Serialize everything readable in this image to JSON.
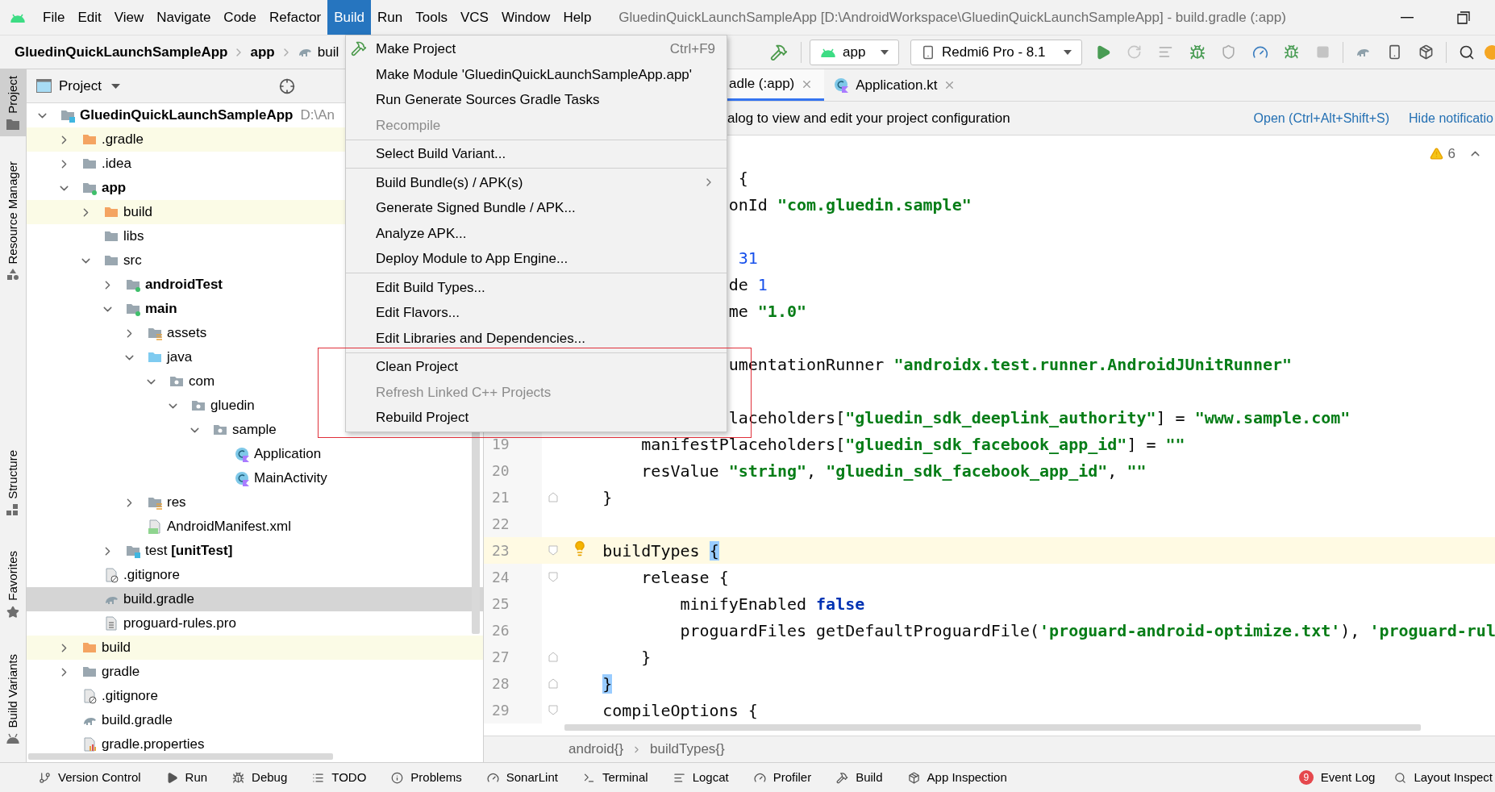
{
  "menu_bar": {
    "items": [
      {
        "label": "File",
        "selected": false
      },
      {
        "label": "Edit",
        "selected": false
      },
      {
        "label": "View",
        "selected": false
      },
      {
        "label": "Navigate",
        "selected": false
      },
      {
        "label": "Code",
        "selected": false
      },
      {
        "label": "Refactor",
        "selected": false
      },
      {
        "label": "Build",
        "selected": true
      },
      {
        "label": "Run",
        "selected": false
      },
      {
        "label": "Tools",
        "selected": false
      },
      {
        "label": "VCS",
        "selected": false
      },
      {
        "label": "Window",
        "selected": false
      },
      {
        "label": "Help",
        "selected": false
      }
    ],
    "title": "GluedinQuickLaunchSampleApp [D:\\AndroidWorkspace\\GluedinQuickLaunchSampleApp] - build.gradle (:app)"
  },
  "navigation_bar": {
    "crumbs": [
      {
        "label": "GluedinQuickLaunchSampleApp",
        "kind": "project"
      },
      {
        "label": "app",
        "kind": "module"
      },
      {
        "label": "buil",
        "kind": "gradle"
      }
    ],
    "run_config": "app",
    "device": "Redmi6 Pro - 8.1"
  },
  "tool_strip": [
    {
      "label": "Project",
      "kind": "project",
      "selected": true
    },
    {
      "label": "Resource Manager",
      "kind": "resources",
      "selected": false
    },
    {
      "label": "Structure",
      "kind": "structure",
      "selected": false
    },
    {
      "label": "Favorites",
      "kind": "favorites",
      "selected": false
    },
    {
      "label": "Build Variants",
      "kind": "variants",
      "selected": false
    }
  ],
  "project_panel": {
    "title": "Project",
    "tree": [
      {
        "name": "GluedinQuickLaunchSampleApp",
        "path": "D:\\An",
        "kind": "project",
        "expanded": true,
        "selected": false,
        "children": [
          {
            "name": ".gradle",
            "kind": "excluded",
            "expanded": false,
            "selected": false
          },
          {
            "name": ".idea",
            "kind": "folder",
            "expanded": false,
            "selected": false
          },
          {
            "name": "app",
            "kind": "module",
            "expanded": true,
            "selected": false,
            "children": [
              {
                "name": "build",
                "kind": "excluded",
                "expanded": false,
                "selected": false
              },
              {
                "name": "libs",
                "kind": "folder",
                "selected": false
              },
              {
                "name": "src",
                "kind": "folder",
                "expanded": true,
                "selected": false,
                "children": [
                  {
                    "name": "androidTest",
                    "kind": "source-set",
                    "expanded": false,
                    "selected": false
                  },
                  {
                    "name": "main",
                    "kind": "source-set",
                    "expanded": true,
                    "selected": false,
                    "children": [
                      {
                        "name": "assets",
                        "kind": "resource",
                        "expanded": false,
                        "selected": false
                      },
                      {
                        "name": "java",
                        "kind": "source-root",
                        "expanded": true,
                        "selected": false,
                        "children": [
                          {
                            "name": "com",
                            "kind": "package",
                            "expanded": true,
                            "selected": false,
                            "children": [
                              {
                                "name": "gluedin",
                                "kind": "package",
                                "expanded": true,
                                "selected": false,
                                "children": [
                                  {
                                    "name": "sample",
                                    "kind": "package",
                                    "expanded": true,
                                    "selected": false,
                                    "children": [
                                      {
                                        "name": "Application",
                                        "kind": "class",
                                        "selected": false
                                      },
                                      {
                                        "name": "MainActivity",
                                        "kind": "class",
                                        "selected": false
                                      }
                                    ]
                                  }
                                ]
                              }
                            ]
                          }
                        ]
                      },
                      {
                        "name": "res",
                        "kind": "resource",
                        "expanded": false,
                        "selected": false
                      },
                      {
                        "name": "AndroidManifest.xml",
                        "kind": "manifest",
                        "selected": false
                      }
                    ]
                  },
                  {
                    "name": "test **[unitTest]**",
                    "kind": "test-set",
                    "expanded": false,
                    "selected": false
                  }
                ]
              },
              {
                "name": ".gitignore",
                "kind": "ignore",
                "selected": false
              },
              {
                "name": "build.gradle",
                "kind": "gradle",
                "selected": true
              },
              {
                "name": "proguard-rules.pro",
                "kind": "text",
                "selected": false
              }
            ]
          },
          {
            "name": "build",
            "kind": "excluded",
            "expanded": false,
            "selected": false
          },
          {
            "name": "gradle",
            "kind": "folder",
            "expanded": false,
            "selected": false
          },
          {
            "name": ".gitignore",
            "kind": "ignore",
            "selected": false
          },
          {
            "name": "build.gradle",
            "kind": "gradle",
            "selected": false
          },
          {
            "name": "gradle.properties",
            "kind": "properties",
            "selected": false
          }
        ]
      }
    ]
  },
  "editor": {
    "tabs": [
      {
        "label": "adle (:app)",
        "selected": true
      },
      {
        "label": "Application.kt",
        "kind": "class",
        "selected": false
      }
    ],
    "notification": {
      "text": "alog to view and edit your project configuration",
      "links": [
        "Open (Ctrl+Alt+Shift+S)",
        "Hide notificatio"
      ]
    },
    "warnings": "6",
    "lines": [
      {
        "kind": "partial"
      },
      {
        "kind": "partial",
        "tokens": [
          {
            "kind": "plain",
            "text": " {"
          }
        ]
      },
      {
        "kind": "partial",
        "tokens": [
          {
            "kind": "plain",
            "text": "onId "
          },
          {
            "kind": "string",
            "text": "\"com.gluedin.sample\""
          }
        ]
      },
      {
        "kind": "partial"
      },
      {
        "kind": "partial",
        "tokens": [
          {
            "kind": "number",
            "text": " 31"
          }
        ]
      },
      {
        "kind": "partial",
        "tokens": [
          {
            "kind": "plain",
            "text": "de "
          },
          {
            "kind": "number",
            "text": "1"
          }
        ]
      },
      {
        "kind": "partial",
        "tokens": [
          {
            "kind": "plain",
            "text": "me "
          },
          {
            "kind": "string",
            "text": "\"1.0\""
          }
        ]
      },
      {
        "kind": "partial"
      },
      {
        "kind": "partial",
        "tokens": [
          {
            "kind": "plain",
            "text": "umentationRunner "
          },
          {
            "kind": "string",
            "text": "\"androidx.test.runner.AndroidJUnitRunner\""
          }
        ]
      },
      {
        "kind": "partial"
      },
      {
        "kind": "partial",
        "tokens": [
          {
            "kind": "plain",
            "text": "laceholders["
          },
          {
            "kind": "string",
            "text": "\"gluedin_sdk_deeplink_authority\""
          },
          {
            "kind": "plain",
            "text": "] = "
          },
          {
            "kind": "string",
            "text": "\"www.sample.com\""
          }
        ]
      },
      {
        "kind": "numbered",
        "number": "19",
        "current": false,
        "fold_start": false,
        "fold_end": false,
        "tokens": [
          {
            "kind": "plain",
            "text": "        manifestPlaceholders["
          },
          {
            "kind": "string",
            "text": "\"gluedin_sdk_facebook_app_id\""
          },
          {
            "kind": "plain",
            "text": "] = "
          },
          {
            "kind": "string",
            "text": "\"\""
          }
        ]
      },
      {
        "kind": "numbered",
        "number": "20",
        "current": false,
        "fold_start": false,
        "fold_end": false,
        "tokens": [
          {
            "kind": "plain",
            "text": "        resValue "
          },
          {
            "kind": "string",
            "text": "\"string\""
          },
          {
            "kind": "plain",
            "text": ", "
          },
          {
            "kind": "string",
            "text": "\"gluedin_sdk_facebook_app_id\""
          },
          {
            "kind": "plain",
            "text": ", "
          },
          {
            "kind": "string",
            "text": "\"\""
          }
        ]
      },
      {
        "kind": "numbered",
        "number": "21",
        "current": false,
        "fold_start": false,
        "fold_end": true,
        "tokens": [
          {
            "kind": "plain",
            "text": "    }"
          }
        ]
      },
      {
        "kind": "numbered",
        "number": "22",
        "current": false,
        "fold_start": false,
        "fold_end": false
      },
      {
        "kind": "numbered",
        "number": "23",
        "current": true,
        "fold_start": true,
        "fold_end": false,
        "tokens": [
          {
            "kind": "plain",
            "text": "    buildTypes "
          },
          {
            "kind": "match",
            "text": "{"
          }
        ]
      },
      {
        "kind": "numbered",
        "number": "24",
        "current": false,
        "fold_start": true,
        "fold_end": false,
        "tokens": [
          {
            "kind": "plain",
            "text": "        release {"
          }
        ]
      },
      {
        "kind": "numbered",
        "number": "25",
        "current": false,
        "fold_start": false,
        "fold_end": false,
        "tokens": [
          {
            "kind": "plain",
            "text": "            minifyEnabled "
          },
          {
            "kind": "keyword",
            "text": "false"
          }
        ]
      },
      {
        "kind": "numbered",
        "number": "26",
        "current": false,
        "fold_start": false,
        "fold_end": false,
        "tokens": [
          {
            "kind": "plain",
            "text": "            proguardFiles getDefaultProguardFile("
          },
          {
            "kind": "string",
            "text": "'proguard-android-optimize.txt'"
          },
          {
            "kind": "plain",
            "text": "), "
          },
          {
            "kind": "string",
            "text": "'proguard-rul"
          }
        ]
      },
      {
        "kind": "numbered",
        "number": "27",
        "current": false,
        "fold_start": false,
        "fold_end": true,
        "tokens": [
          {
            "kind": "plain",
            "text": "        }"
          }
        ]
      },
      {
        "kind": "numbered",
        "number": "28",
        "current": false,
        "fold_start": false,
        "fold_end": true,
        "tokens": [
          {
            "kind": "match",
            "text": "    }"
          }
        ]
      },
      {
        "kind": "numbered",
        "number": "29",
        "current": false,
        "fold_start": true,
        "fold_end": false,
        "tokens": [
          {
            "kind": "plain",
            "text": "    compileOptions {"
          }
        ]
      }
    ],
    "breadcrumb": [
      "android{}",
      "buildTypes{}"
    ]
  },
  "build_menu": [
    {
      "kind": "action",
      "label": "Make Project",
      "shortcut": "Ctrl+F9",
      "disabled": false
    },
    {
      "kind": "item",
      "label": "Make Module 'GluedinQuickLaunchSampleApp.app'",
      "disabled": false
    },
    {
      "kind": "item",
      "label": "Run Generate Sources Gradle Tasks",
      "disabled": false
    },
    {
      "kind": "item",
      "label": "Recompile",
      "disabled": true
    },
    {
      "kind": "separator"
    },
    {
      "kind": "item",
      "label": "Select Build Variant...",
      "disabled": false
    },
    {
      "kind": "separator"
    },
    {
      "kind": "submenu",
      "label": "Build Bundle(s) / APK(s)",
      "disabled": false
    },
    {
      "kind": "item",
      "label": "Generate Signed Bundle / APK...",
      "disabled": false
    },
    {
      "kind": "item",
      "label": "Analyze APK...",
      "disabled": false
    },
    {
      "kind": "item",
      "label": "Deploy Module to App Engine...",
      "disabled": false
    },
    {
      "kind": "separator"
    },
    {
      "kind": "item",
      "label": "Edit Build Types...",
      "disabled": false
    },
    {
      "kind": "item",
      "label": "Edit Flavors...",
      "disabled": false
    },
    {
      "kind": "item",
      "label": "Edit Libraries and Dependencies...",
      "disabled": false
    },
    {
      "kind": "separator"
    },
    {
      "kind": "item",
      "label": "Clean Project",
      "disabled": false
    },
    {
      "kind": "item",
      "label": "Refresh Linked C++ Projects",
      "disabled": true
    },
    {
      "kind": "item",
      "label": "Rebuild Project",
      "disabled": false
    }
  ],
  "bottom_bar": {
    "left": [
      {
        "label": "Version Control",
        "kind": "vcs"
      },
      {
        "label": "Run",
        "kind": "run"
      },
      {
        "label": "Debug",
        "kind": "debug"
      },
      {
        "label": "TODO",
        "kind": "todo"
      },
      {
        "label": "Problems",
        "kind": "problems"
      },
      {
        "label": "SonarLint",
        "kind": "sonarlint"
      },
      {
        "label": "Terminal",
        "kind": "terminal"
      },
      {
        "label": "Logcat",
        "kind": "logcat"
      },
      {
        "label": "Profiler",
        "kind": "profiler"
      },
      {
        "label": "Build",
        "kind": "build"
      },
      {
        "label": "App Inspection",
        "kind": "inspection"
      }
    ],
    "right": [
      {
        "label": "Event Log",
        "kind": "events",
        "badge": "9"
      },
      {
        "label": "Layout Inspect",
        "kind": "layout"
      }
    ]
  }
}
